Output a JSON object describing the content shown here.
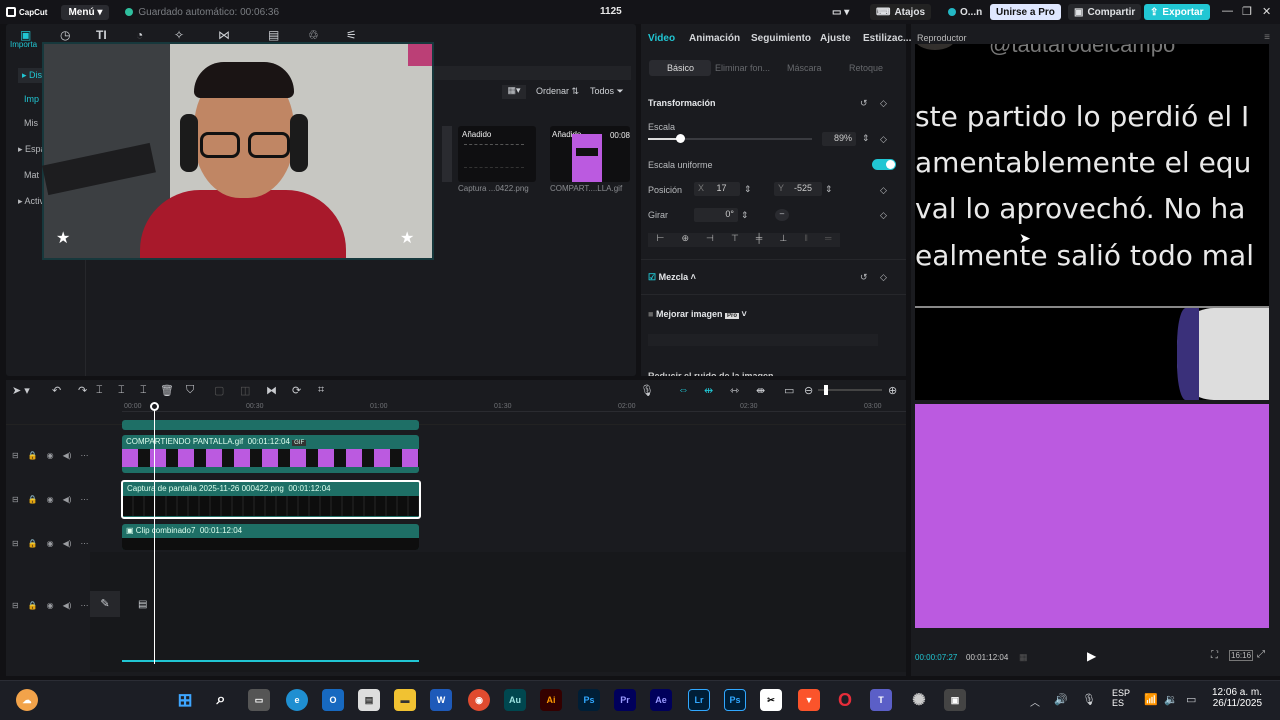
{
  "titlebar": {
    "app_name": "CapCut",
    "menu_label": "Menú",
    "autosave": "Guardado automático: 00:06:36",
    "project_name": "1125",
    "layout_label": "Atajos",
    "account_label": "O...n",
    "pro_label": "Unirse a Pro",
    "share_label": "Compartir",
    "export_label": "Exportar"
  },
  "media": {
    "sidebar": [
      "Disp",
      "Imp",
      "Mis",
      "Espa",
      "Mat",
      "Activ"
    ],
    "import_label": "Importa",
    "sort_label": "Ordenar",
    "filter_label": "Todos",
    "thumbs": [
      {
        "badge": "Añadido",
        "name": "Captura ...0422.png"
      },
      {
        "badge": "Añadido",
        "duration": "00:08",
        "name": "COMPART....LLA.gif"
      }
    ]
  },
  "props": {
    "tabs": [
      "Video",
      "Animación",
      "Seguimiento",
      "Ajuste",
      "Estilizac..."
    ],
    "subtabs": [
      "Básico",
      "Eliminar fon...",
      "Máscara",
      "Retoque"
    ],
    "section_transform": "Transformación",
    "scale_label": "Escala",
    "scale_value": "89%",
    "uniform_label": "Escala uniforme",
    "position_label": "Posición",
    "pos_x_label": "X",
    "pos_x": "17",
    "pos_y_label": "Y",
    "pos_y": "-525",
    "rotate_label": "Girar",
    "rotate_value": "0°",
    "blend_label": "Mezcla",
    "enhance_label": "Mejorar imagen",
    "enhance_badge": "Pro",
    "noise_label": "Reducir el ruido de la imagen"
  },
  "player": {
    "title": "Reproductor",
    "lines": [
      "ste partido lo perdió el I",
      "amentablemente el equ",
      "val lo aprovechó. No ha",
      "ealmente salió todo mal"
    ],
    "handle_text": "@tautarodelcampo",
    "current_time": "00:00:07:27",
    "total_time": "00:01:12:04",
    "ratio_label": "16:16"
  },
  "timeline": {
    "ruler": [
      "00:00",
      "00:30",
      "01:00",
      "01:30",
      "02:00",
      "02:30",
      "03:00"
    ],
    "clips": [
      {
        "name": "COMPARTIENDO PANTALLA.gif",
        "duration": "00:01:12:04",
        "tag": "GIF"
      },
      {
        "name": "Captura de pantalla 2025-11-26 000422.png",
        "duration": "00:01:12:04"
      },
      {
        "name": "Clip combinado7",
        "duration": "00:01:12:04"
      }
    ]
  },
  "taskbar": {
    "apps": [
      "Au",
      "Ai",
      "Ps",
      "Pr",
      "Ae",
      "Lr",
      "Ps"
    ],
    "lang_top": "ESP",
    "lang_bottom": "ES",
    "time": "12:06 a. m.",
    "date": "26/11/2025"
  },
  "colors": {
    "accent": "#21c6d3",
    "track": "#1e6f66",
    "purple": "#bb5ae0",
    "pro": "#2ccbd8"
  }
}
